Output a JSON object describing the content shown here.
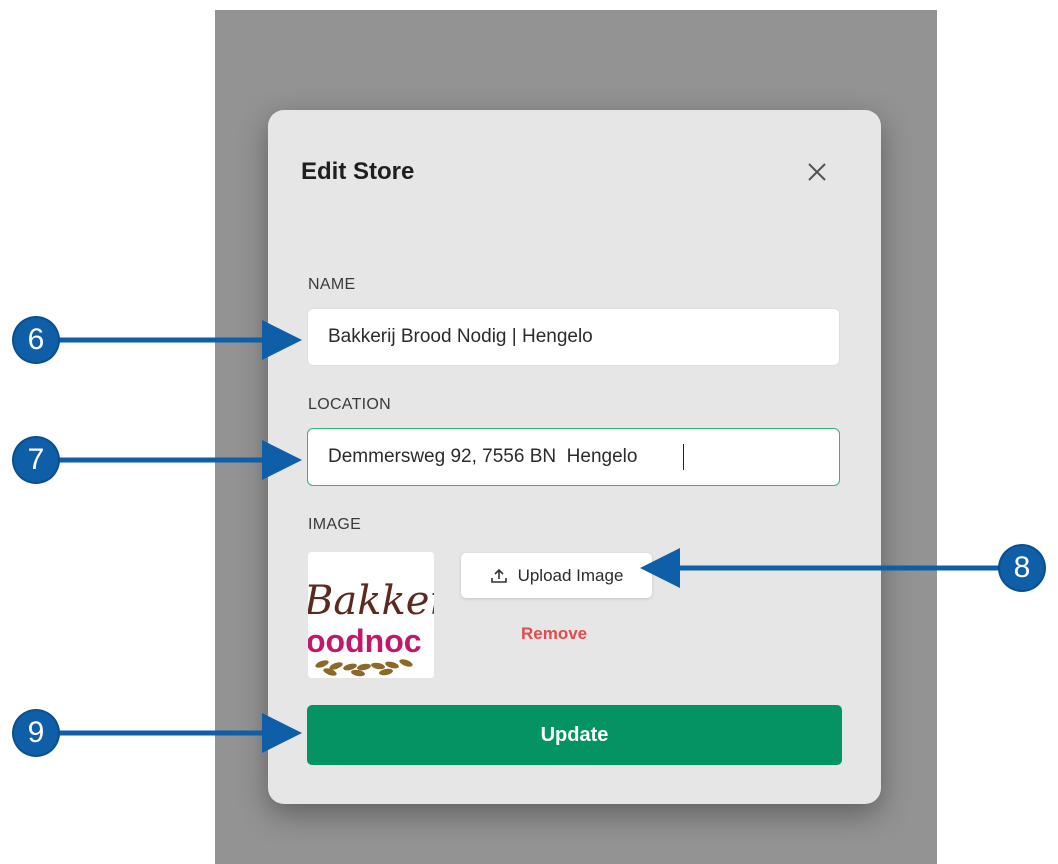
{
  "dialog": {
    "title": "Edit Store",
    "close_icon": "close-icon"
  },
  "form": {
    "name": {
      "label": "NAME",
      "value": "Bakkerij Brood Nodig | Hengelo"
    },
    "location": {
      "label": "LOCATION",
      "value": "Demmersweg 92, 7556 BN  Hengelo"
    },
    "image": {
      "label": "IMAGE",
      "logo_text_top": "Bakkery",
      "logo_text_bottom": "oodnoc",
      "upload_label": "Upload Image",
      "upload_icon": "upload-icon",
      "remove_label": "Remove"
    },
    "submit_label": "Update"
  },
  "callouts": [
    "6",
    "7",
    "8",
    "9"
  ],
  "colors": {
    "accent_green": "#049463",
    "focus_border": "#36b37e",
    "remove_red": "#e04b4b",
    "callout_blue": "#0e5ea8"
  }
}
